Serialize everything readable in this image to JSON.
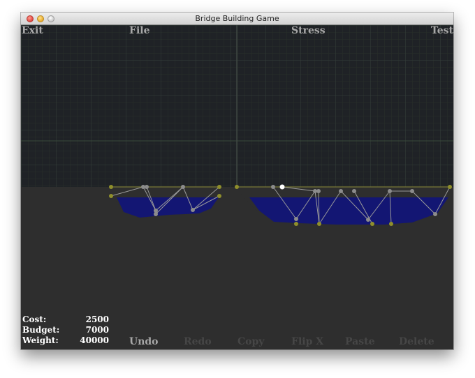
{
  "window": {
    "title": "Bridge Building Game"
  },
  "menu": {
    "exit": "Exit",
    "file": "File",
    "stress": "Stress",
    "test": "Test"
  },
  "stats": {
    "cost_label": "Cost:",
    "cost_value": "2500",
    "budget_label": "Budget:",
    "budget_value": "7000",
    "weight_label": "Weight:",
    "weight_value": "40000"
  },
  "toolbar": {
    "undo": "Undo",
    "redo": "Redo",
    "copy": "Copy",
    "flip_x": "Flip X",
    "paste": "Paste",
    "delete": "Delete"
  },
  "colors": {
    "sky": "#1f2226",
    "ground": "#2e2e2e",
    "water": "#131673",
    "grid": "#2b3530",
    "anchor_node": "#8f8f2c",
    "node": "#8c8c8c",
    "selected_node": "#ffffff",
    "beam": "#9a9a9a",
    "road": "#8c8c3a"
  }
}
